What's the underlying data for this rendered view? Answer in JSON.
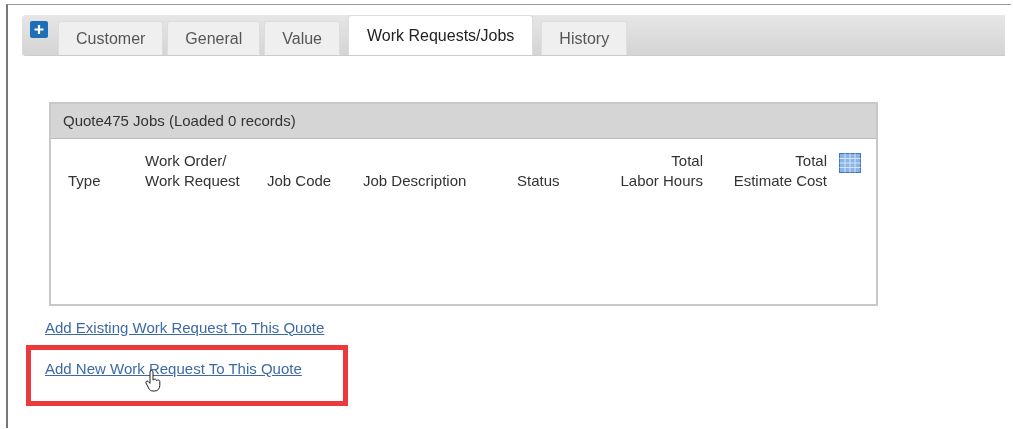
{
  "tabs": [
    {
      "label": "Customer",
      "selected": false
    },
    {
      "label": "General",
      "selected": false
    },
    {
      "label": "Value",
      "selected": false
    },
    {
      "label": "Work Requests/Jobs",
      "selected": true
    },
    {
      "label": "History",
      "selected": false
    }
  ],
  "grid": {
    "title": "Quote475 Jobs (Loaded 0 records)",
    "columns": [
      {
        "label": "Type",
        "kind": "text"
      },
      {
        "label": "Work Order/\nWork Request",
        "kind": "text"
      },
      {
        "label": "Job Code",
        "kind": "text"
      },
      {
        "label": "Job Description",
        "kind": "text"
      },
      {
        "label": "Status",
        "kind": "text"
      },
      {
        "label": "Total\nLabor Hours",
        "kind": "number"
      },
      {
        "label": "Total\nEstimate Cost",
        "kind": "number"
      }
    ]
  },
  "links": [
    {
      "label": "Add Existing Work Request To This Quote",
      "highlighted": false
    },
    {
      "label": "Add New Work Request To This Quote",
      "highlighted": true
    }
  ]
}
